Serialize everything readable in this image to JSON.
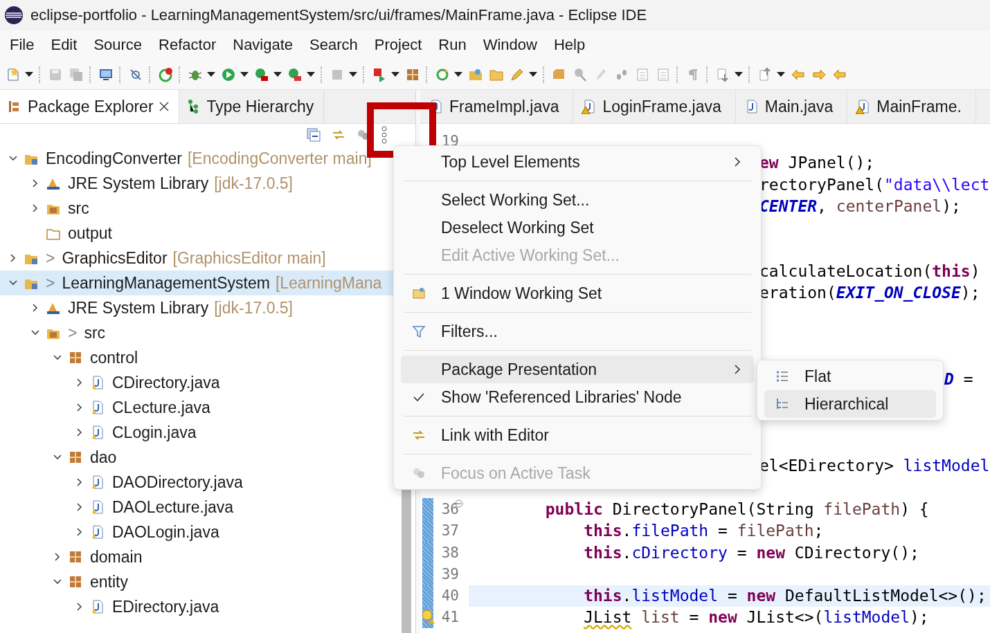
{
  "window": {
    "title": "eclipse-portfolio - LearningManagementSystem/src/ui/frames/MainFrame.java - Eclipse IDE"
  },
  "menu_bar": [
    "File",
    "Edit",
    "Source",
    "Refactor",
    "Navigate",
    "Search",
    "Project",
    "Run",
    "Window",
    "Help"
  ],
  "explorer": {
    "tabs": [
      {
        "label": "Package Explorer",
        "selected": true
      },
      {
        "label": "Type Hierarchy",
        "selected": false
      }
    ],
    "tree": [
      {
        "kind": "project",
        "label": "EncodingConverter",
        "decoration": "[EncodingConverter main]",
        "expanded": true,
        "selected": false,
        "children": [
          {
            "kind": "library",
            "label": "JRE System Library",
            "decoration": "[jdk-17.0.5]",
            "expanded": false,
            "selected": false
          },
          {
            "kind": "source",
            "label": "src",
            "expanded": false,
            "selected": false
          },
          {
            "kind": "folder",
            "label": "output",
            "selected": false
          }
        ]
      },
      {
        "kind": "project",
        "prefix": ">",
        "label": "GraphicsEditor",
        "decoration": "[GraphicsEditor main]",
        "expanded": false,
        "selected": false
      },
      {
        "kind": "project",
        "prefix": ">",
        "label": "LearningManagementSystem",
        "decoration": "[LearningMana",
        "expanded": true,
        "selected": true,
        "children": [
          {
            "kind": "library",
            "label": "JRE System Library",
            "decoration": "[jdk-17.0.5]",
            "expanded": false,
            "selected": false
          },
          {
            "kind": "source",
            "prefix": ">",
            "label": "src",
            "expanded": true,
            "selected": false,
            "children": [
              {
                "kind": "package",
                "label": "control",
                "expanded": true,
                "selected": false,
                "children": [
                  {
                    "kind": "java",
                    "label": "CDirectory.java",
                    "expanded": false,
                    "selected": false
                  },
                  {
                    "kind": "java",
                    "label": "CLecture.java",
                    "expanded": false,
                    "selected": false
                  },
                  {
                    "kind": "java",
                    "label": "CLogin.java",
                    "expanded": false,
                    "selected": false
                  }
                ]
              },
              {
                "kind": "package",
                "label": "dao",
                "expanded": true,
                "selected": false,
                "children": [
                  {
                    "kind": "java",
                    "label": "DAODirectory.java",
                    "expanded": false,
                    "selected": false
                  },
                  {
                    "kind": "java",
                    "label": "DAOLecture.java",
                    "expanded": false,
                    "selected": false
                  },
                  {
                    "kind": "java",
                    "label": "DAOLogin.java",
                    "expanded": false,
                    "selected": false
                  }
                ]
              },
              {
                "kind": "package",
                "label": "domain",
                "expanded": false,
                "selected": false
              },
              {
                "kind": "package",
                "label": "entity",
                "expanded": true,
                "selected": false,
                "children": [
                  {
                    "kind": "java",
                    "label": "EDirectory.java",
                    "expanded": false,
                    "selected": false
                  }
                ]
              }
            ]
          }
        ]
      }
    ]
  },
  "editor": {
    "tabs": [
      {
        "label": "FrameImpl.java",
        "warning": false
      },
      {
        "label": "LoginFrame.java",
        "warning": true
      },
      {
        "label": "Main.java",
        "warning": false
      },
      {
        "label": "MainFrame.",
        "warning": true
      }
    ],
    "lines": [
      {
        "kind": "blank"
      },
      {
        "number": "19",
        "kind": "blank"
      },
      {
        "kind": "after_menu",
        "segments": [
          {
            "kind": "keyword",
            "text": "ew"
          },
          {
            "kind": "plain",
            "text": " JPanel();"
          }
        ]
      },
      {
        "kind": "after_menu",
        "segments": [
          {
            "kind": "plain",
            "text": "rectoryPanel("
          },
          {
            "kind": "string",
            "text": "\"data\\\\lect"
          }
        ]
      },
      {
        "kind": "after_menu",
        "segments": [
          {
            "kind": "constant",
            "text": "CENTER"
          },
          {
            "kind": "plain",
            "text": ", "
          },
          {
            "kind": "local",
            "text": "centerPanel"
          },
          {
            "kind": "plain",
            "text": ");"
          }
        ]
      },
      {
        "kind": "blank"
      },
      {
        "kind": "blank"
      },
      {
        "kind": "after_menu",
        "segments": [
          {
            "kind": "plain",
            "text": "calculateLocation("
          },
          {
            "kind": "keyword",
            "text": "this"
          },
          {
            "kind": "plain",
            "text": ")"
          }
        ]
      },
      {
        "kind": "after_menu",
        "segments": [
          {
            "kind": "plain",
            "text": "eration("
          },
          {
            "kind": "constant",
            "text": "EXIT_ON_CLOSE"
          },
          {
            "kind": "plain",
            "text": ");"
          }
        ]
      },
      {
        "kind": "blank"
      },
      {
        "kind": "blank"
      },
      {
        "kind": "blank"
      },
      {
        "kind": "after_submenu",
        "segments": [
          {
            "kind": "constant",
            "text": "D"
          },
          {
            "kind": "plain",
            "text": " ="
          }
        ]
      },
      {
        "kind": "blank"
      },
      {
        "kind": "blank"
      },
      {
        "kind": "blank"
      },
      {
        "kind": "after_menu",
        "segments": [
          {
            "kind": "plain",
            "text": "el<EDirectory> "
          },
          {
            "kind": "field",
            "text": "listModel"
          }
        ]
      },
      {
        "kind": "blank"
      },
      {
        "number": "36",
        "kind": "outer",
        "changed": true,
        "foldable": true,
        "quickfix": false,
        "segments": [
          {
            "kind": "keyword",
            "text": "public"
          },
          {
            "kind": "plain",
            "text": " DirectoryPanel(String "
          },
          {
            "kind": "local",
            "text": "filePath"
          },
          {
            "kind": "plain",
            "text": ") {"
          }
        ]
      },
      {
        "number": "37",
        "kind": "inner",
        "changed": true,
        "foldable": false,
        "quickfix": false,
        "segments": [
          {
            "kind": "keyword",
            "text": "this"
          },
          {
            "kind": "plain",
            "text": "."
          },
          {
            "kind": "field",
            "text": "filePath"
          },
          {
            "kind": "plain",
            "text": " = "
          },
          {
            "kind": "local",
            "text": "filePath"
          },
          {
            "kind": "plain",
            "text": ";"
          }
        ]
      },
      {
        "number": "38",
        "kind": "inner",
        "changed": true,
        "foldable": false,
        "quickfix": false,
        "segments": [
          {
            "kind": "keyword",
            "text": "this"
          },
          {
            "kind": "plain",
            "text": "."
          },
          {
            "kind": "field",
            "text": "cDirectory"
          },
          {
            "kind": "plain",
            "text": " = "
          },
          {
            "kind": "keyword",
            "text": "new"
          },
          {
            "kind": "plain",
            "text": " CDirectory();"
          }
        ]
      },
      {
        "number": "39",
        "kind": "blank",
        "changed": true,
        "foldable": false,
        "quickfix": false
      },
      {
        "number": "40",
        "kind": "inner",
        "changed": true,
        "foldable": false,
        "quickfix": false,
        "current": true,
        "segments": [
          {
            "kind": "keyword",
            "text": "this"
          },
          {
            "kind": "plain",
            "text": "."
          },
          {
            "kind": "field",
            "text": "listModel"
          },
          {
            "kind": "plain",
            "text": " = "
          },
          {
            "kind": "keyword",
            "text": "new"
          },
          {
            "kind": "plain",
            "text": " DefaultListModel<>();"
          }
        ]
      },
      {
        "number": "41",
        "kind": "inner",
        "changed": true,
        "foldable": false,
        "quickfix": true,
        "segments": [
          {
            "kind": "plain",
            "text": "JList",
            "warning": true
          },
          {
            "kind": "local",
            "text": " list"
          },
          {
            "kind": "plain",
            "text": " = "
          },
          {
            "kind": "keyword",
            "text": "new"
          },
          {
            "kind": "plain",
            "text": " JList<>("
          },
          {
            "kind": "field",
            "text": "listModel"
          },
          {
            "kind": "plain",
            "text": ");"
          }
        ]
      }
    ]
  },
  "view_menu": {
    "items": [
      {
        "kind": "submenu",
        "label": "Top Level Elements",
        "selected": false,
        "disabled": false,
        "checked": false
      },
      {
        "kind": "separator"
      },
      {
        "kind": "action",
        "label": "Select Working Set...",
        "selected": false,
        "disabled": false,
        "checked": false
      },
      {
        "kind": "action",
        "label": "Deselect Working Set",
        "selected": false,
        "disabled": false,
        "checked": false
      },
      {
        "kind": "action",
        "label": "Edit Active Working Set...",
        "selected": false,
        "disabled": true,
        "checked": false
      },
      {
        "kind": "separator"
      },
      {
        "kind": "working_set",
        "label": "1 Window Working Set",
        "selected": false,
        "disabled": false,
        "checked": false
      },
      {
        "kind": "separator"
      },
      {
        "kind": "filters",
        "label": "Filters...",
        "selected": false,
        "disabled": false,
        "checked": false
      },
      {
        "kind": "separator"
      },
      {
        "kind": "submenu",
        "label": "Package Presentation",
        "selected": true,
        "disabled": false,
        "checked": false
      },
      {
        "kind": "action",
        "label": "Show 'Referenced Libraries' Node",
        "selected": false,
        "disabled": false,
        "checked": true
      },
      {
        "kind": "separator"
      },
      {
        "kind": "link",
        "label": "Link with Editor",
        "selected": false,
        "disabled": false,
        "checked": false
      },
      {
        "kind": "separator"
      },
      {
        "kind": "focus",
        "label": "Focus on Active Task",
        "selected": false,
        "disabled": true,
        "checked": false
      }
    ],
    "submenu": [
      {
        "kind": "flat",
        "label": "Flat",
        "selected": false
      },
      {
        "kind": "hierarchical",
        "label": "Hierarchical",
        "selected": true
      }
    ]
  }
}
